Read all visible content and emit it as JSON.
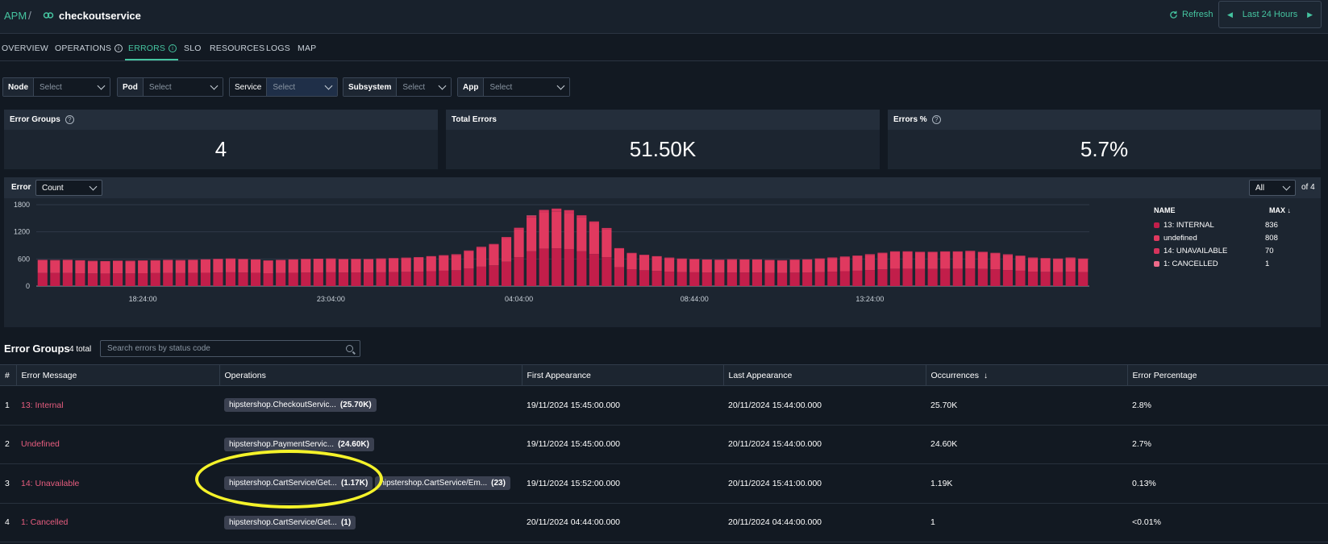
{
  "breadcrumb": {
    "root": "APM",
    "separator": "/",
    "service": "checkoutservice"
  },
  "header": {
    "refresh_label": "Refresh",
    "time_range": "Last 24 Hours"
  },
  "tabs": [
    {
      "label": "OVERVIEW"
    },
    {
      "label": "OPERATIONS"
    },
    {
      "label": "ERRORS"
    },
    {
      "label": "SLO"
    },
    {
      "label": "RESOURCES"
    },
    {
      "label": "LOGS"
    },
    {
      "label": "MAP"
    }
  ],
  "filters": [
    {
      "label": "Node",
      "value": "Select"
    },
    {
      "label": "Pod",
      "value": "Select"
    },
    {
      "label": "Service",
      "value": "Select"
    },
    {
      "label": "Subsystem",
      "value": "Select"
    },
    {
      "label": "App",
      "value": "Select"
    }
  ],
  "stats": [
    {
      "label": "Error Groups",
      "value": "4"
    },
    {
      "label": "Total Errors",
      "value": "51.50K"
    },
    {
      "label": "Errors %",
      "value": "5.7%"
    }
  ],
  "chart_panel": {
    "label": "Error",
    "metric": "Count",
    "series_filter": "All",
    "of_label": "of 4"
  },
  "legend": {
    "name_header": "NAME",
    "max_header": "MAX",
    "items": [
      {
        "name": "13: INTERNAL",
        "max": "836",
        "color": "#c21e4a"
      },
      {
        "name": "undefined",
        "max": "808",
        "color": "#e0395f"
      },
      {
        "name": "14: UNAVAILABLE",
        "max": "70",
        "color": "#d6345c"
      },
      {
        "name": "1: CANCELLED",
        "max": "1",
        "color": "#ef6b8a"
      }
    ]
  },
  "chart_data": {
    "type": "bar",
    "stacked": true,
    "ylim": [
      0,
      1800
    ],
    "yticks": [
      0,
      600,
      1200,
      1800
    ],
    "xtick_labels": [
      {
        "label": "18:24:00",
        "index": 8
      },
      {
        "label": "23:04:00",
        "index": 23
      },
      {
        "label": "04:04:00",
        "index": 38
      },
      {
        "label": "08:44:00",
        "index": 52
      },
      {
        "label": "13:24:00",
        "index": 66
      }
    ],
    "series": [
      {
        "name": "13: INTERNAL",
        "color": "#c21e4a",
        "values": [
          290,
          290,
          290,
          285,
          280,
          278,
          282,
          280,
          285,
          288,
          290,
          288,
          292,
          295,
          300,
          305,
          300,
          295,
          285,
          290,
          295,
          300,
          303,
          305,
          300,
          302,
          300,
          305,
          310,
          315,
          320,
          330,
          340,
          350,
          390,
          430,
          460,
          540,
          640,
          770,
          830,
          836,
          820,
          770,
          710,
          640,
          420,
          370,
          350,
          335,
          320,
          310,
          305,
          300,
          298,
          302,
          300,
          300,
          295,
          292,
          298,
          300,
          310,
          320,
          330,
          340,
          355,
          370,
          385,
          385,
          380,
          380,
          385,
          385,
          390,
          380,
          370,
          355,
          340,
          320,
          315,
          310,
          320,
          310
        ]
      },
      {
        "name": "undefined",
        "color": "#e0395f",
        "values": [
          280,
          278,
          280,
          275,
          270,
          268,
          272,
          270,
          273,
          276,
          280,
          278,
          282,
          285,
          290,
          295,
          290,
          285,
          275,
          280,
          285,
          290,
          293,
          295,
          290,
          292,
          290,
          295,
          300,
          305,
          310,
          320,
          330,
          340,
          380,
          420,
          450,
          520,
          620,
          750,
          800,
          808,
          800,
          750,
          690,
          620,
          400,
          350,
          330,
          315,
          300,
          290,
          285,
          280,
          278,
          282,
          280,
          280,
          275,
          272,
          278,
          280,
          290,
          300,
          310,
          320,
          335,
          350,
          365,
          365,
          360,
          360,
          365,
          365,
          370,
          360,
          350,
          335,
          320,
          300,
          295,
          290,
          300,
          290
        ]
      },
      {
        "name": "14: UNAVAILABLE",
        "color": "#d6345c",
        "values": [
          10,
          9,
          11,
          12,
          10,
          8,
          10,
          11,
          12,
          9,
          10,
          11,
          10,
          12,
          13,
          11,
          10,
          10,
          9,
          10,
          11,
          12,
          10,
          11,
          10,
          9,
          10,
          12,
          11,
          10,
          12,
          13,
          14,
          15,
          18,
          20,
          22,
          25,
          30,
          40,
          55,
          70,
          60,
          45,
          30,
          25,
          20,
          15,
          14,
          12,
          11,
          10,
          10,
          9,
          10,
          11,
          10,
          10,
          9,
          10,
          11,
          12,
          12,
          13,
          14,
          15,
          16,
          18,
          20,
          20,
          18,
          18,
          19,
          19,
          20,
          18,
          16,
          14,
          13,
          12,
          11,
          10,
          12,
          10
        ]
      },
      {
        "name": "1: CANCELLED",
        "color": "#ef6b8a",
        "values": [
          0,
          0,
          0,
          0,
          0,
          0,
          0,
          0,
          0,
          0,
          0,
          0,
          0,
          0,
          0,
          0,
          0,
          0,
          0,
          0,
          0,
          0,
          0,
          0,
          0,
          0,
          0,
          0,
          0,
          0,
          0,
          0,
          0,
          0,
          0,
          0,
          0,
          0,
          0,
          1,
          0,
          0,
          0,
          0,
          0,
          0,
          0,
          0,
          0,
          0,
          0,
          0,
          0,
          0,
          0,
          0,
          0,
          0,
          0,
          0,
          0,
          0,
          0,
          0,
          0,
          0,
          0,
          0,
          0,
          0,
          0,
          0,
          0,
          0,
          0,
          0,
          0,
          0,
          0,
          0,
          0,
          0,
          0,
          0
        ]
      }
    ]
  },
  "error_groups": {
    "title": "Error Groups",
    "count_label": "4 total",
    "search_placeholder": "Search errors by status code",
    "columns": [
      "#",
      "Error Message",
      "Operations",
      "First Appearance",
      "Last Appearance",
      "Occurrences",
      "Error Percentage"
    ],
    "rows": [
      {
        "num": "1",
        "message": "13: Internal",
        "ops": [
          {
            "name": "hipstershop.CheckoutServic...",
            "count": "(25.70K)"
          }
        ],
        "first": "19/11/2024 15:45:00.000",
        "last": "20/11/2024 15:44:00.000",
        "occurrences": "25.70K",
        "percentage": "2.8%"
      },
      {
        "num": "2",
        "message": "Undefined",
        "ops": [
          {
            "name": "hipstershop.PaymentServic...",
            "count": "(24.60K)"
          }
        ],
        "first": "19/11/2024 15:45:00.000",
        "last": "20/11/2024 15:44:00.000",
        "occurrences": "24.60K",
        "percentage": "2.7%"
      },
      {
        "num": "3",
        "message": "14: Unavailable",
        "ops": [
          {
            "name": "hipstershop.CartService/Get...",
            "count": "(1.17K)"
          },
          {
            "name": "hipstershop.CartService/Em...",
            "count": "(23)"
          }
        ],
        "first": "19/11/2024 15:52:00.000",
        "last": "20/11/2024 15:41:00.000",
        "occurrences": "1.19K",
        "percentage": "0.13%"
      },
      {
        "num": "4",
        "message": "1: Cancelled",
        "ops": [
          {
            "name": "hipstershop.CartService/Get...",
            "count": "(1)"
          }
        ],
        "first": "20/11/2024 04:44:00.000",
        "last": "20/11/2024 04:44:00.000",
        "occurrences": "1",
        "percentage": "<0.01%"
      }
    ]
  }
}
